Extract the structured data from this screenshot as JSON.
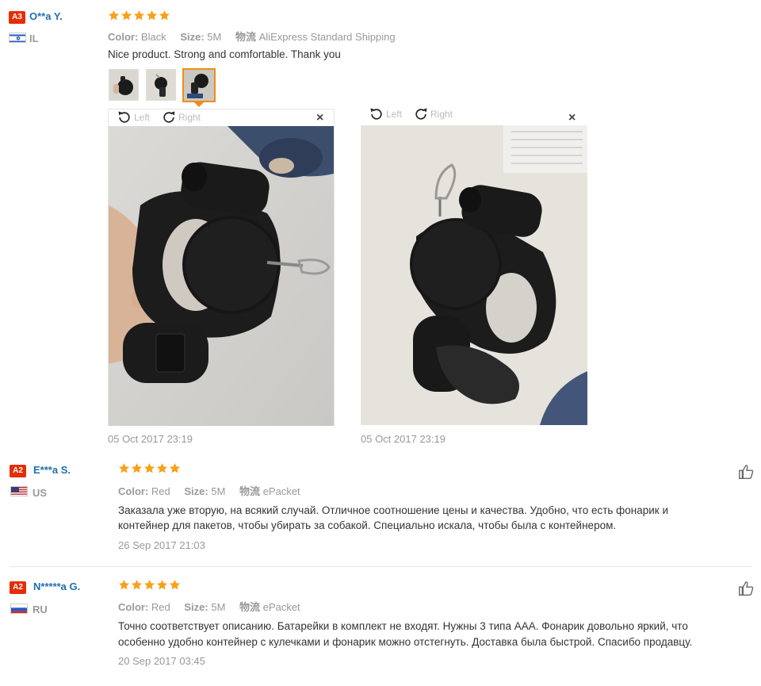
{
  "reviews": [
    {
      "level": "A3",
      "name": "O**a Y.",
      "country": "IL",
      "color_label": "Color:",
      "color_value": "Black",
      "size_label": "Size:",
      "size_value": "5M",
      "logistics_label": "物流",
      "logistics_value": "AliExpress Standard Shipping",
      "text": "Nice product. Strong and comfortable. Thank you",
      "rotate_left": "Left",
      "rotate_right": "Right",
      "close": "×",
      "dates": [
        "05 Oct 2017 23:19",
        "05 Oct 2017 23:19"
      ]
    },
    {
      "level": "A2",
      "name": "E***a S.",
      "country": "US",
      "color_label": "Color:",
      "color_value": "Red",
      "size_label": "Size:",
      "size_value": "5M",
      "logistics_label": "物流",
      "logistics_value": "ePacket",
      "text_line1": "Заказала уже вторую, на всякий случай. Отличное соотношение цены и качества. Удобно, что есть фонарик и",
      "text_line2": "контейнер для пакетов, чтобы убирать за собакой. Специально искала, чтобы была с контейнером.",
      "date": "26 Sep 2017 21:03"
    },
    {
      "level": "A2",
      "name": "N*****a G.",
      "country": "RU",
      "color_label": "Color:",
      "color_value": "Red",
      "size_label": "Size:",
      "size_value": "5M",
      "logistics_label": "物流",
      "logistics_value": "ePacket",
      "text_line1": "Точно соответствует описанию. Батарейки в комплект не входят. Нужны 3 типа ААА. Фонарик довольно яркий, что",
      "text_line2": "особенно удобно контейнер с кулечками и фонарик можно отстегнуть. Доставка была быстрой. Спасибо продавцу.",
      "date": "20 Sep 2017 03:45"
    }
  ],
  "colors": {
    "star": "#f7a11a",
    "badge": "#e62e04",
    "name": "#1f6fb5",
    "meta": "#999999",
    "thumb_active_border": "#f08c1d"
  },
  "icons": [
    "star-icon",
    "flag-il-icon",
    "flag-us-icon",
    "flag-ru-icon",
    "rotate-left-icon",
    "rotate-right-icon",
    "close-icon",
    "thumbs-up-icon"
  ],
  "rating": [
    5,
    5,
    5
  ]
}
